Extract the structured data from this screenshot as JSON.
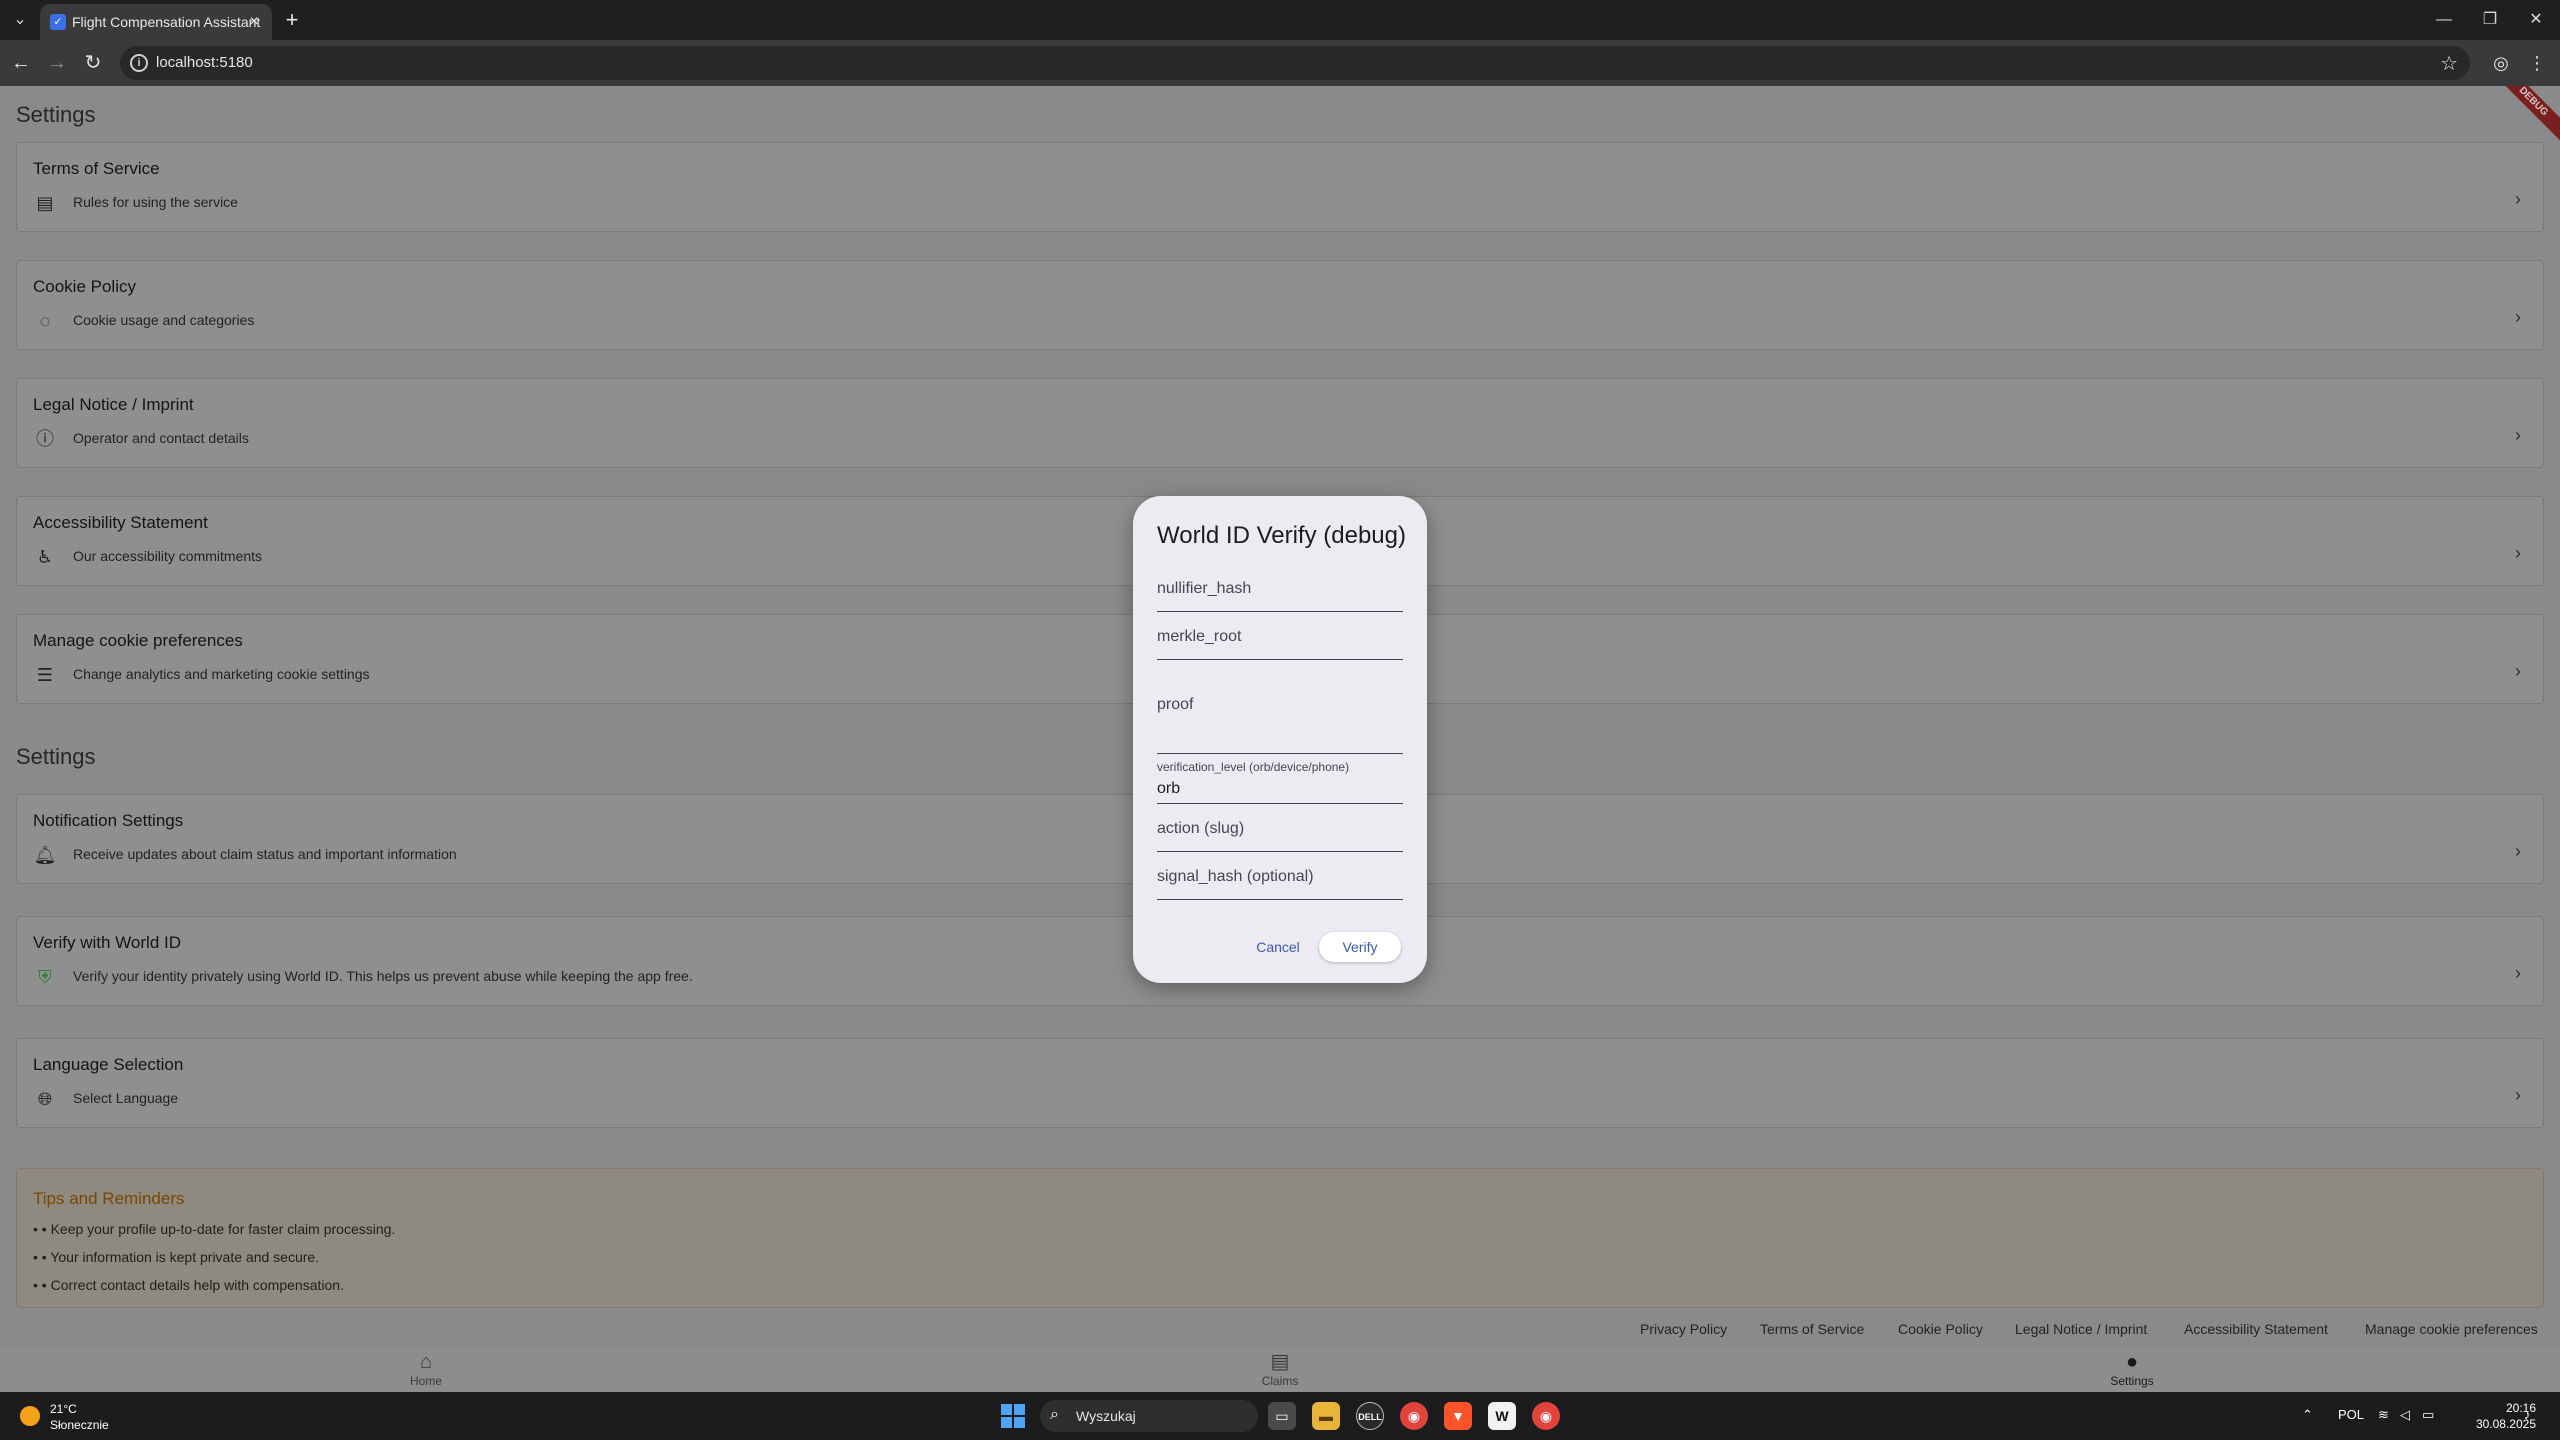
{
  "browser": {
    "tab_title": "Flight Compensation Assistant",
    "url": "localhost:5180"
  },
  "page": {
    "section1_title": "Settings",
    "section2_title": "Settings",
    "legal_items": [
      {
        "title": "Terms of Service",
        "subtitle": "Rules for using the service",
        "icon": "document-icon"
      },
      {
        "title": "Cookie Policy",
        "subtitle": "Cookie usage and categories",
        "icon": "cookie-icon"
      },
      {
        "title": "Legal Notice / Imprint",
        "subtitle": "Operator and contact details",
        "icon": "info-icon"
      },
      {
        "title": "Accessibility Statement",
        "subtitle": "Our accessibility commitments",
        "icon": "accessibility-icon"
      },
      {
        "title": "Manage cookie preferences",
        "subtitle": "Change analytics and marketing cookie settings",
        "icon": "tune-icon"
      }
    ],
    "settings_items": [
      {
        "title": "Notification Settings",
        "subtitle": "Receive updates about claim status and important information",
        "icon": "bell-icon"
      },
      {
        "title": "Verify with World ID",
        "subtitle": "Verify your identity privately using World ID. This helps us prevent abuse while keeping the app free.",
        "icon": "shield-check-icon"
      },
      {
        "title": "Language Selection",
        "subtitle": "Select Language",
        "icon": "globe-icon"
      }
    ],
    "tips": {
      "title": "Tips and Reminders",
      "items": [
        "• • Keep your profile up-to-date for faster claim processing.",
        "• • Your information is kept private and secure.",
        "• • Correct contact details help with compensation."
      ]
    },
    "debug_banner": "DEBUG",
    "footer_links": [
      "Privacy Policy",
      "Terms of Service",
      "Cookie Policy",
      "Legal Notice / Imprint",
      "Accessibility Statement",
      "Manage cookie preferences"
    ],
    "bottom_nav": [
      {
        "label": "Home",
        "icon": "home-icon"
      },
      {
        "label": "Claims",
        "icon": "document-icon"
      },
      {
        "label": "Settings",
        "icon": "person-icon",
        "active": true
      }
    ]
  },
  "dialog": {
    "title": "World ID Verify (debug)",
    "fields": {
      "nullifier_hash": {
        "placeholder": "nullifier_hash"
      },
      "merkle_root": {
        "placeholder": "merkle_root"
      },
      "proof": {
        "placeholder": "proof"
      },
      "verification_level": {
        "label": "verification_level (orb/device/phone)",
        "value": "orb"
      },
      "action": {
        "placeholder": "action (slug)"
      },
      "signal_hash": {
        "placeholder": "signal_hash (optional)"
      }
    },
    "cancel_label": "Cancel",
    "verify_label": "Verify"
  },
  "taskbar": {
    "weather_temp": "21°C",
    "weather_desc": "Słonecznie",
    "search_placeholder": "Wyszukaj",
    "language": "POL",
    "time": "20:16",
    "date": "30.08.2025"
  },
  "colors": {
    "scrim_background": "#8a8a8a",
    "dialog_background": "#edeaf2",
    "dialog_button_text": "#3b5ba9",
    "tips_title": "#7a4600",
    "shield_green": "#2e7d32"
  }
}
